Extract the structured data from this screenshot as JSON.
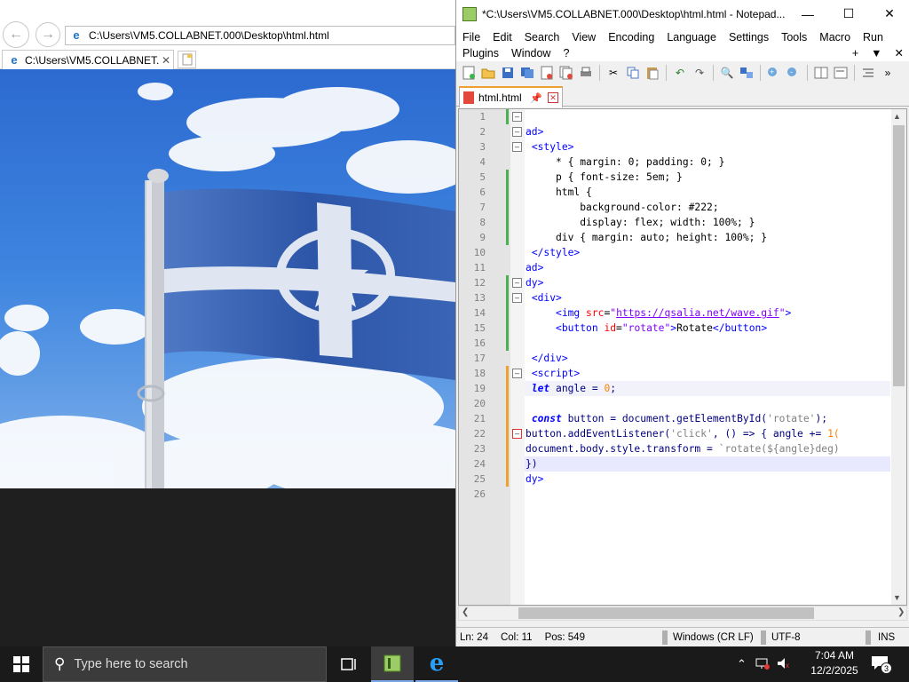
{
  "ie": {
    "address": "C:\\Users\\VM5.COLLABNET.000\\Desktop\\html.html",
    "tab_title": "C:\\Users\\VM5.COLLABNET....",
    "tab_close": "✕"
  },
  "notepad": {
    "title": "*C:\\Users\\VM5.COLLABNET.000\\Desktop\\html.html - Notepad...",
    "menu_row1": [
      "File",
      "Edit",
      "Search",
      "View",
      "Encoding",
      "Language",
      "Settings",
      "Tools",
      "Macro",
      "Run"
    ],
    "menu_row2": [
      "Plugins",
      "Window",
      "?"
    ],
    "menu_extra": [
      "+",
      "▼",
      "✕"
    ],
    "doc_tab": "html.html",
    "lines": [
      "1",
      "2",
      "3",
      "4",
      "5",
      "6",
      "7",
      "8",
      "9",
      "10",
      "11",
      "12",
      "13",
      "14",
      "15",
      "16",
      "17",
      "18",
      "19",
      "20",
      "21",
      "22",
      "23",
      "24",
      "25",
      "26"
    ],
    "status": {
      "ln": "Ln: 24",
      "col": "Col: 11",
      "pos": "Pos: 549",
      "eol": "Windows (CR LF)",
      "enc": "UTF-8",
      "mode": "INS"
    }
  },
  "taskbar": {
    "search_placeholder": "Type here to search",
    "time": "7:04 AM",
    "date": "12/2/2025",
    "notification_count": "3"
  }
}
